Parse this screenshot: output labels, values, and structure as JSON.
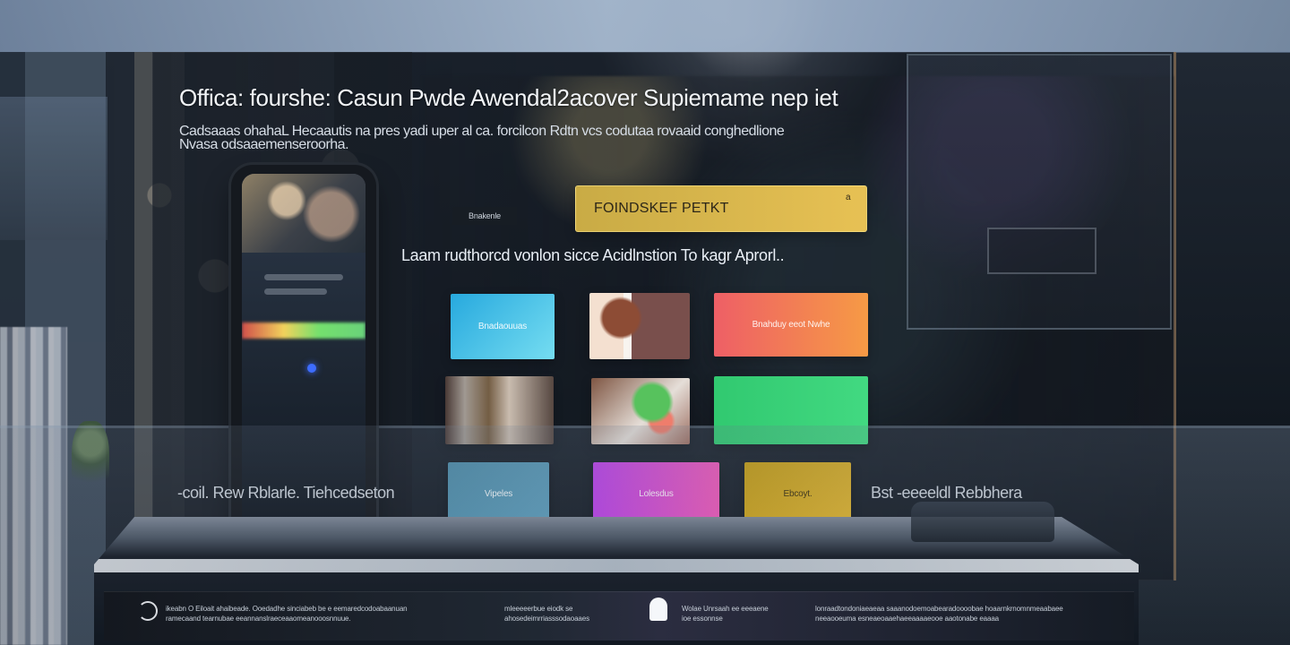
{
  "header": {
    "title": "Offica: fourshe: Casun Pwde Awendal2acover Supiemame nep iet",
    "subtitle_lines": [
      "Cadsaaas ohahaL Hecaautis na pres yadi uper al ca.     forcilcon Rdtn vcs codutaa rovaaid  conghedlione",
      "Nvasa odsaaemenseroorha."
    ]
  },
  "phone": {
    "label": "Bnakenle"
  },
  "search": {
    "value": "FOINDSKEF PETKT",
    "mark": "a"
  },
  "main": {
    "tagline": "Laam rudthorcd vonlon sicce Acidlnstion To kagr Aprorl.."
  },
  "tiles": [
    {
      "label": "Bnadaouuas"
    },
    {
      "label": ""
    },
    {
      "label": "Bnahduy eeot Nwhe"
    },
    {
      "label": ""
    },
    {
      "label": ""
    },
    {
      "label": ""
    },
    {
      "label": "Vipeles"
    },
    {
      "label": "Lolesdus"
    },
    {
      "label": "Ebcoyt."
    }
  ],
  "side_labels": {
    "left": "-coil. Rew Rblarle. Tiehcedseton",
    "right": "Bst -eeeeldl Rebbhera"
  },
  "footer": {
    "segment_1": {
      "line_1": "ikeabn O Eiloait ahaibeade. Ooedadhe sinciabeb be e eemaredcodoabaanuan",
      "line_2": "ramecaand tearnubae eeannanslraeceaaomeanooosnnuue."
    },
    "segment_2": {
      "line_1": "mleeeeerbue eiodk se",
      "line_2": "ahosedeimrriasssodaoaaes"
    },
    "segment_3": {
      "line_1": "Wolae Unrsaah ee eeeaene",
      "line_2": "ioe essonnse"
    },
    "segment_4": {
      "line_1": "lonraadtondoniaeaeaa saaanodoemoabearadoooobae hoaarnkrnomnmeaabaee",
      "line_2": "neeaooeuma esneaeoaaehaeeaaaaeooe aaotonabe eaaaa"
    }
  },
  "colors": {
    "search_fill": "#d8b64e",
    "blue_tile": "#2fb6e0",
    "orange_tile": "#f27b55",
    "green_tile": "#38d178",
    "pink_tile": "#d94fd0",
    "gold_tile": "#d3a928"
  },
  "icons": {
    "footer_left": "partial-circle-icon",
    "footer_middle": "device-icon"
  }
}
